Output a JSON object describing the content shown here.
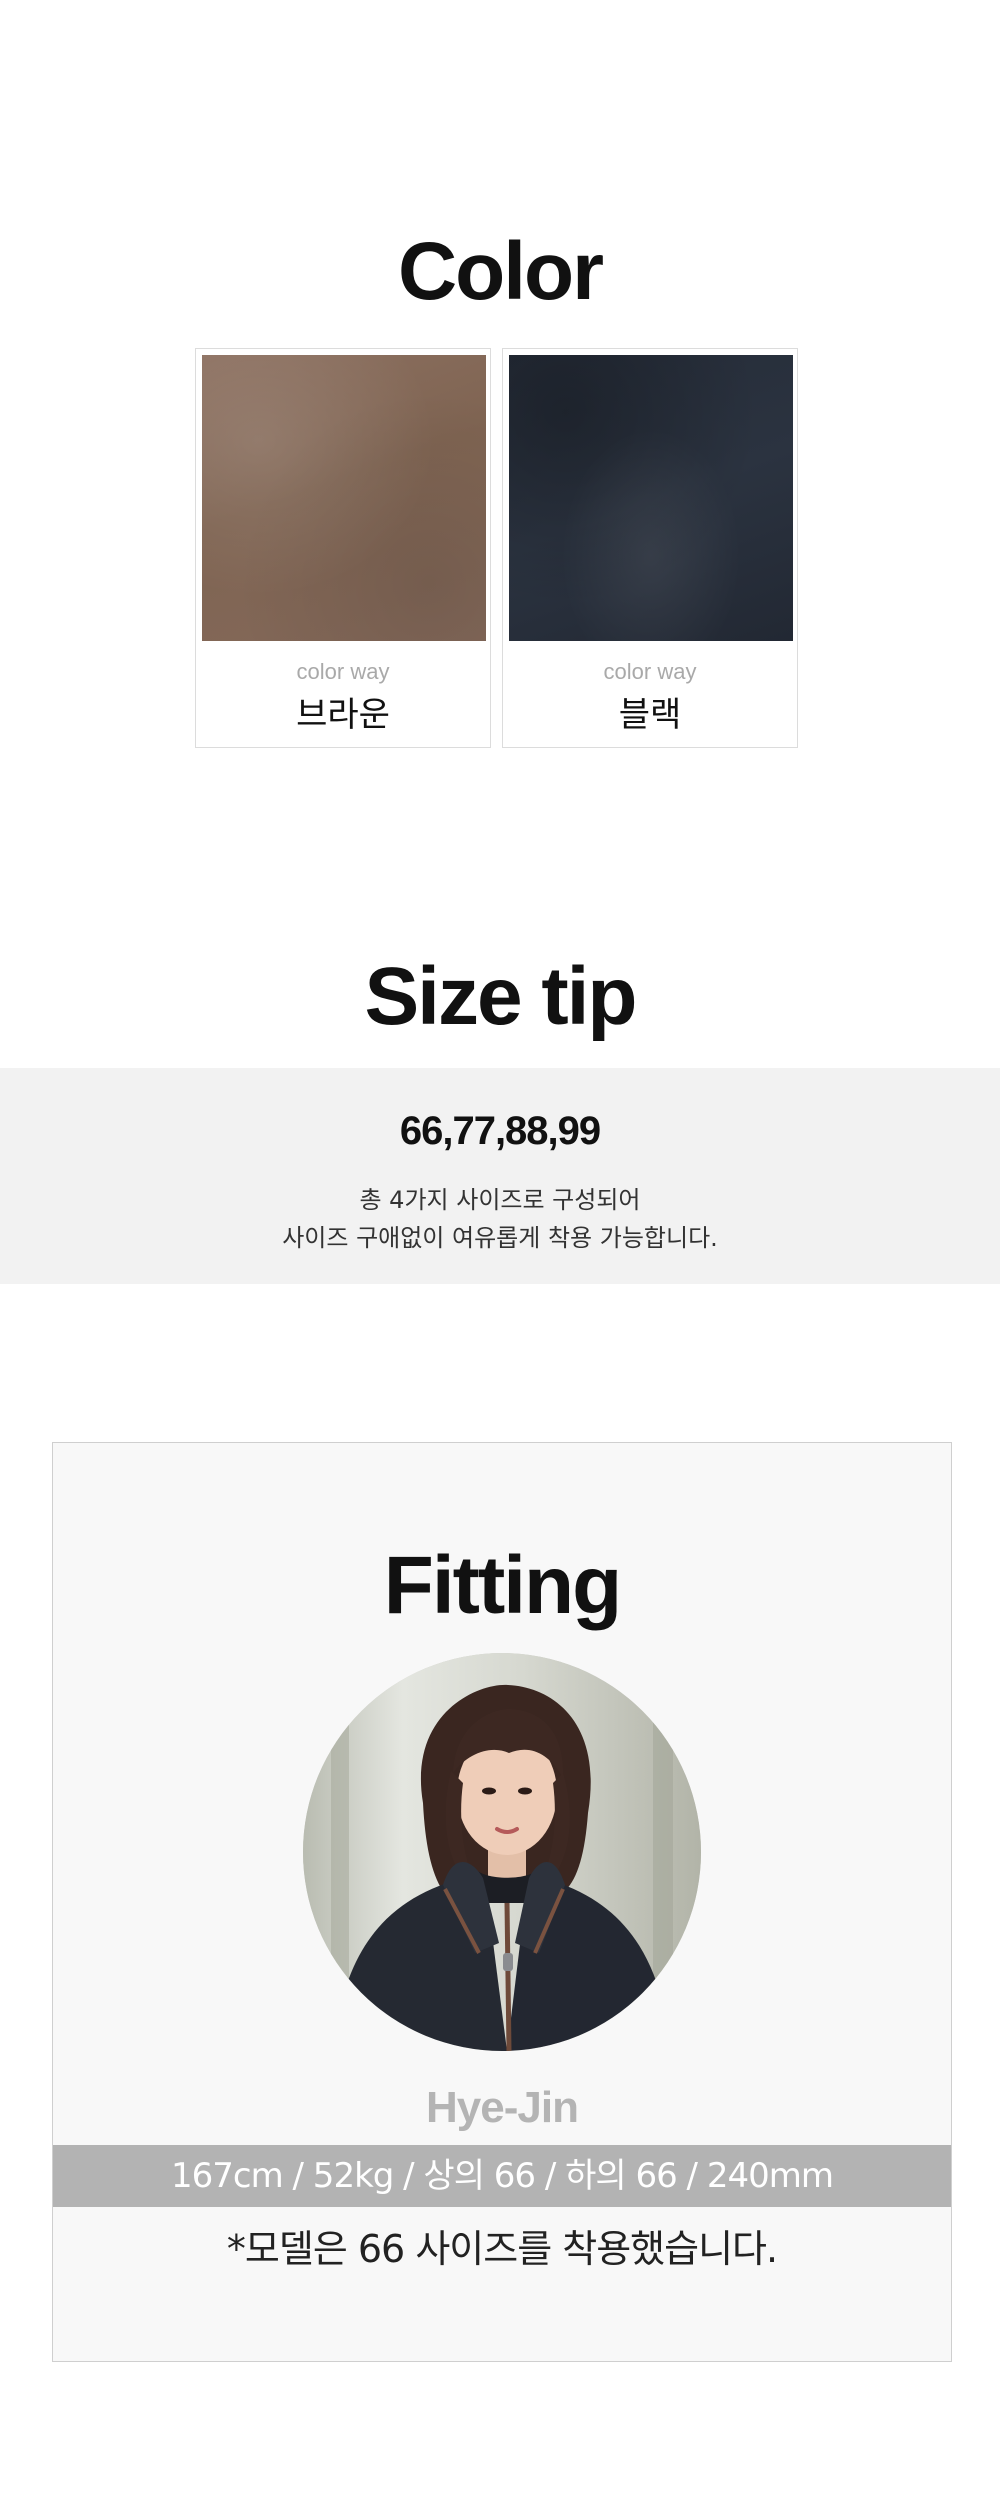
{
  "color_section": {
    "title": "Color",
    "swatches": [
      {
        "caption": "color way",
        "name": "브라운",
        "color": "#84695a"
      },
      {
        "caption": "color way",
        "name": "블랙",
        "color": "#2a313c"
      }
    ]
  },
  "size_tip": {
    "title": "Size tip",
    "sizes": "66,77,88,99",
    "desc_line1": "총 4가지 사이즈로 구성되어",
    "desc_line2": "사이즈 구애없이 여유롭게 착용 가능합니다."
  },
  "fitting": {
    "title": "Fitting",
    "model_name": "Hye-Jin",
    "stats": "167cm / 52kg / 상의 66 / 하의 66 / 240mm",
    "note": "*모델은 66 사이즈를 착용했습니다."
  },
  "colors": {
    "band_bg": "#f2f2f2",
    "stats_bar": "#b3b3b3",
    "model_name": "#b4b4b4"
  }
}
